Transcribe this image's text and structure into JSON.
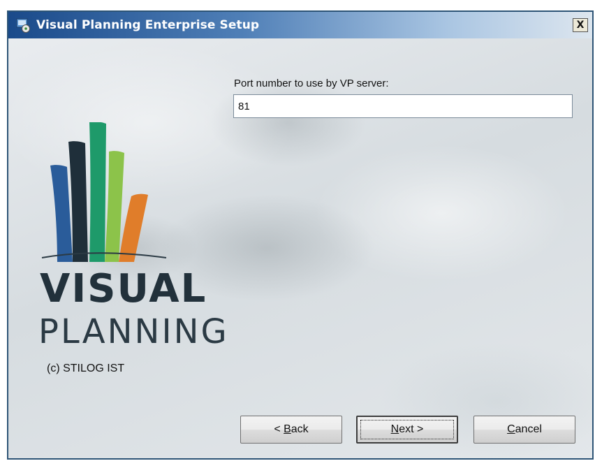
{
  "window": {
    "title": "Visual Planning Enterprise Setup",
    "close_label": "X"
  },
  "icons": {
    "app": "setup-installer-icon",
    "close": "close-icon"
  },
  "brand": {
    "line1": "VISUAL",
    "line2": "PLANNING",
    "copyright": "(c) STILOG IST",
    "logo_colors": [
      "#2a5c9a",
      "#1f2f3a",
      "#1e9a6a",
      "#8cc34a",
      "#e07d2a"
    ]
  },
  "form": {
    "port_label": "Port number to use by VP server:",
    "port_value": "81"
  },
  "buttons": {
    "back": {
      "prefix": "< ",
      "accel": "B",
      "rest": "ack"
    },
    "next": {
      "accel": "N",
      "rest": "ext >"
    },
    "cancel": {
      "accel": "C",
      "rest": "ancel"
    }
  }
}
